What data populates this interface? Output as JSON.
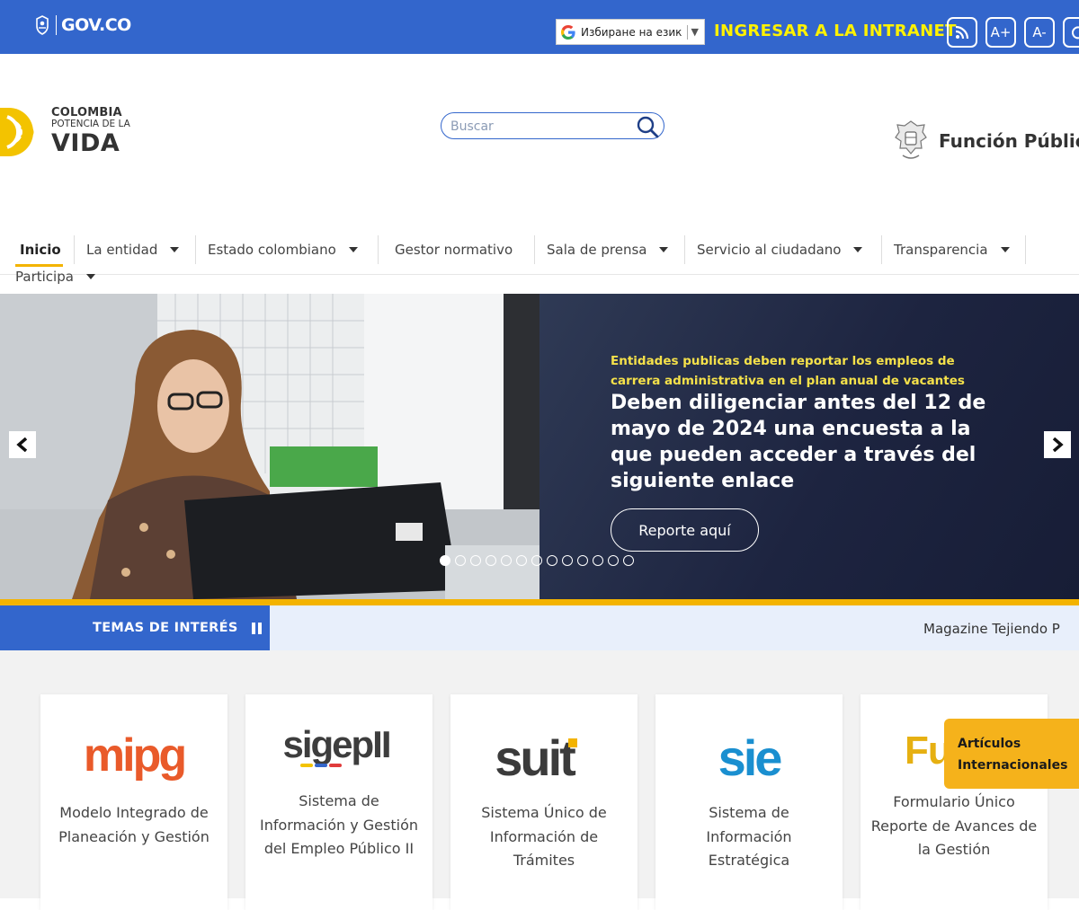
{
  "govbar": {
    "logo_text": "GOV.CO",
    "language_select": "Избиране на език",
    "intranet_link": "INGRESAR A LA INTRANET",
    "tools": [
      "rss-icon",
      "font-increase",
      "font-decrease",
      "contrast-icon"
    ],
    "font_increase_label": "A+",
    "font_decrease_label": "A-",
    "accent_color": "#fff200",
    "bar_color": "#3366cc"
  },
  "header": {
    "brand_line1": "COLOMBIA",
    "brand_line2": "POTENCIA DE LA",
    "brand_line3": "VIDA",
    "search_placeholder": "Buscar",
    "entity_logo_text": "Función Públic"
  },
  "nav": {
    "items": [
      {
        "label": "Inicio",
        "active": true
      },
      {
        "label": "La entidad",
        "dropdown": true
      },
      {
        "label": "Estado colombiano",
        "dropdown": true
      },
      {
        "label": "Gestor normativo"
      },
      {
        "label": "Sala de prensa",
        "dropdown": true
      },
      {
        "label": "Servicio al ciudadano",
        "dropdown": true
      },
      {
        "label": "Transparencia",
        "dropdown": true
      },
      {
        "label": "Participa",
        "dropdown": true
      }
    ]
  },
  "hero": {
    "kicker": "Entidades publicas deben reportar los empleos de carrera administrativa en el plan anual de vacantes",
    "title": "Deben diligenciar antes del 12 de mayo de 2024 una encuesta a la que pueden acceder a través del siguiente enlace",
    "button": "Reporte aquí",
    "slide_count": 13,
    "active_slide": 1,
    "highlight_color": "#f3b300"
  },
  "temas": {
    "label": "TEMAS DE INTERÉS",
    "ticker": "Magazine Tejiendo P"
  },
  "cards": [
    {
      "logo": "mipg",
      "text": "Modelo Integrado de Planeación y Gestión"
    },
    {
      "logo": "sigepII",
      "text": "Sistema de Información y Gestión del Empleo Público II"
    },
    {
      "logo": "suit",
      "text": "Sistema Único de Información de Trámites"
    },
    {
      "logo": "sie",
      "text": "Sistema de Información Estratégica"
    },
    {
      "logo": "Furag",
      "text": "Formulario Único Reporte de Avances de la Gestión"
    }
  ],
  "floating": {
    "articulos": "Artículos Internacionales"
  }
}
